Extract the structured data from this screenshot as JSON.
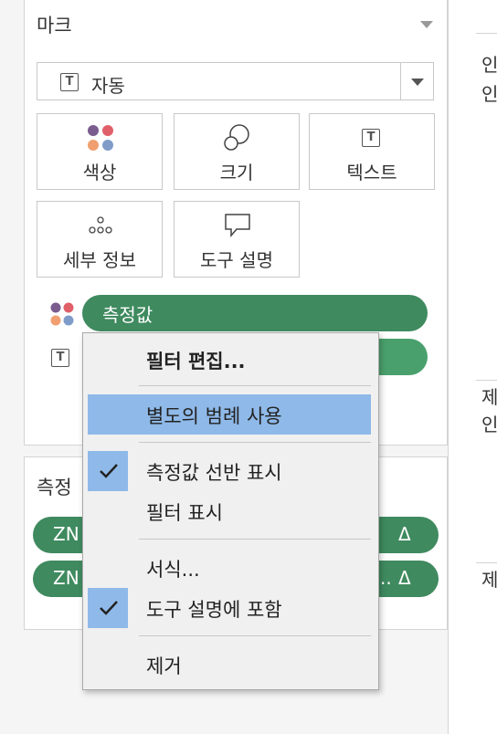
{
  "marks": {
    "title": "마크",
    "mark_type": "자동",
    "buttons": {
      "color": "색상",
      "size": "크기",
      "text": "텍스트",
      "detail": "세부 정보",
      "tooltip": "도구 설명"
    },
    "pills": {
      "measure_values": "측정값"
    }
  },
  "measures": {
    "title": "측정",
    "items": [
      {
        "label_left": "ZN",
        "label_right": "Δ"
      },
      {
        "label_left": "ZN",
        "label_right": "Δ"
      }
    ]
  },
  "context_menu": {
    "items": {
      "edit_filter": "필터 편집...",
      "separate_legends": "별도의 범례 사용",
      "show_measure_values_shelf": "측정값 선반 표시",
      "show_filter": "필터 표시",
      "format": "서식...",
      "include_in_tooltip": "도구 설명에 포함",
      "remove": "제거"
    }
  },
  "right_panel": {
    "snippets": [
      "인",
      "인",
      "제",
      "인",
      "제"
    ]
  },
  "colors": {
    "pill_green": "#3f8a5f",
    "highlight_blue": "#8fb9e8",
    "dot_purple": "#7a5c8e",
    "dot_red": "#e0606a",
    "dot_orange": "#f0a070",
    "dot_blue": "#7f9cc8"
  }
}
